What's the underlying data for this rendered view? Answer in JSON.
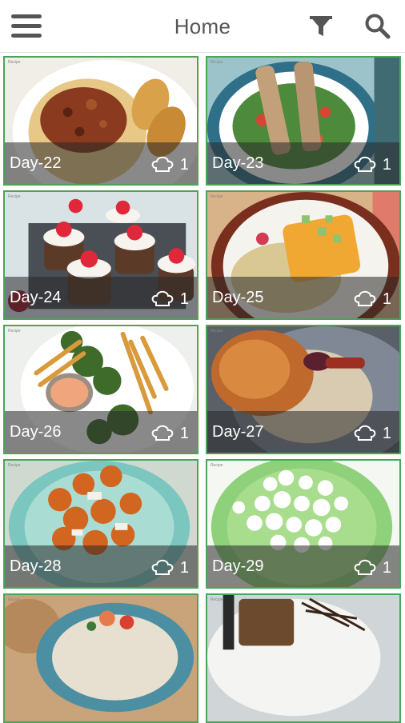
{
  "header": {
    "title": "Home",
    "menu_icon": "hamburger-menu-icon",
    "filter_icon": "filter-icon",
    "search_icon": "search-icon"
  },
  "colors": {
    "card_border": "#4ca35a",
    "icon_gray": "#555555",
    "overlay": "rgba(40,40,40,0.55)"
  },
  "cards": [
    {
      "label": "Day-22",
      "count": "1",
      "icon": "chef-hat-icon"
    },
    {
      "label": "Day-23",
      "count": "1",
      "icon": "chef-hat-icon"
    },
    {
      "label": "Day-24",
      "count": "1",
      "icon": "chef-hat-icon"
    },
    {
      "label": "Day-25",
      "count": "1",
      "icon": "chef-hat-icon"
    },
    {
      "label": "Day-26",
      "count": "1",
      "icon": "chef-hat-icon"
    },
    {
      "label": "Day-27",
      "count": "1",
      "icon": "chef-hat-icon"
    },
    {
      "label": "Day-28",
      "count": "1",
      "icon": "chef-hat-icon"
    },
    {
      "label": "Day-29",
      "count": "1",
      "icon": "chef-hat-icon"
    },
    {
      "label": "",
      "count": "",
      "icon": "chef-hat-icon"
    },
    {
      "label": "",
      "count": "",
      "icon": "chef-hat-icon"
    }
  ]
}
